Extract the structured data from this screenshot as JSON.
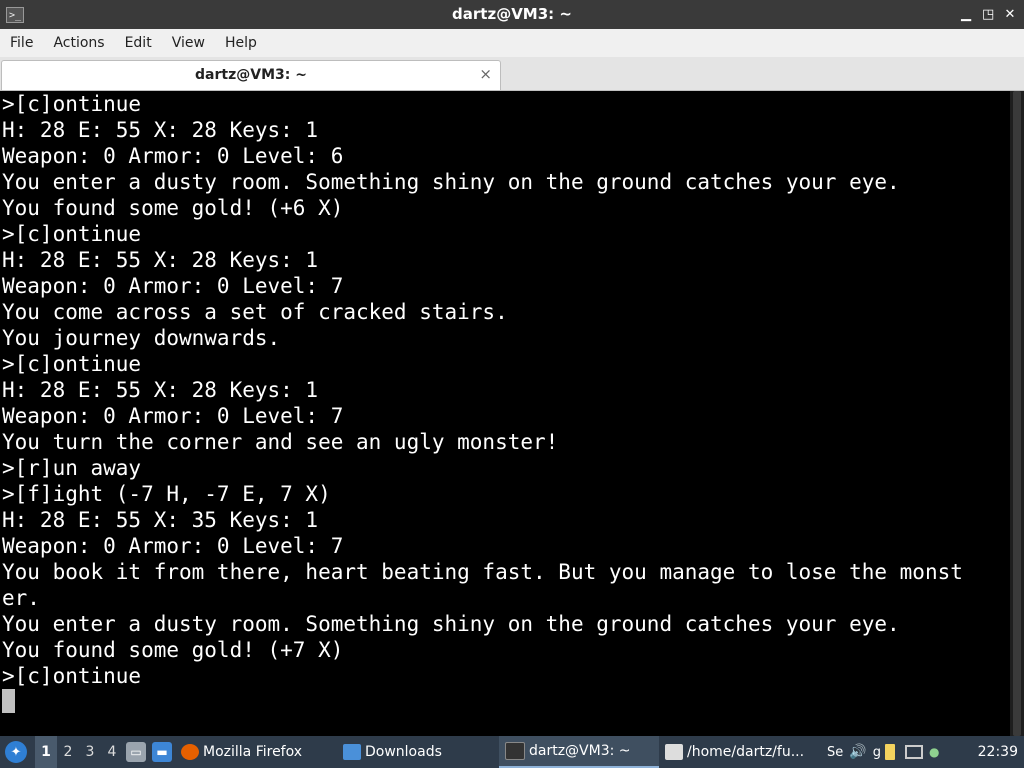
{
  "window": {
    "title": "dartz@VM3: ~",
    "controls": {
      "minimize": "▁",
      "restore": "◳",
      "close": "✕"
    }
  },
  "menu": [
    "File",
    "Actions",
    "Edit",
    "View",
    "Help"
  ],
  "tab": {
    "label": "dartz@VM3: ~",
    "close": "×"
  },
  "terminal": {
    "lines": [
      ">[c]ontinue",
      "H: 28 E: 55 X: 28 Keys: 1",
      "Weapon: 0 Armor: 0 Level: 6",
      "You enter a dusty room. Something shiny on the ground catches your eye.",
      "You found some gold! (+6 X)",
      ">[c]ontinue",
      "H: 28 E: 55 X: 28 Keys: 1",
      "Weapon: 0 Armor: 0 Level: 7",
      "You come across a set of cracked stairs.",
      "You journey downwards.",
      ">[c]ontinue",
      "H: 28 E: 55 X: 28 Keys: 1",
      "Weapon: 0 Armor: 0 Level: 7",
      "You turn the corner and see an ugly monster!",
      ">[r]un away",
      ">[f]ight (-7 H, -7 E, 7 X)",
      "H: 28 E: 55 X: 35 Keys: 1",
      "Weapon: 0 Armor: 0 Level: 7",
      "You book it from there, heart beating fast. But you manage to lose the monst",
      "er.",
      "You enter a dusty room. Something shiny on the ground catches your eye.",
      "You found some gold! (+7 X)",
      ">[c]ontinue"
    ]
  },
  "taskbar": {
    "workspaces": [
      "1",
      "2",
      "3",
      "4"
    ],
    "active_workspace": "1",
    "tasks": [
      {
        "label": "Mozilla Firefox",
        "icon": "firefox-icon",
        "color": "#e66000"
      },
      {
        "label": "Downloads",
        "icon": "folder-icon",
        "color": "#4a90d9"
      },
      {
        "label": "dartz@VM3: ~",
        "icon": "terminal-icon",
        "color": "#333333"
      },
      {
        "label": "/home/dartz/fu...",
        "icon": "text-editor-icon",
        "color": "#dddddd"
      }
    ],
    "tray_text": [
      "Se",
      "g"
    ],
    "clock": "22:39"
  }
}
